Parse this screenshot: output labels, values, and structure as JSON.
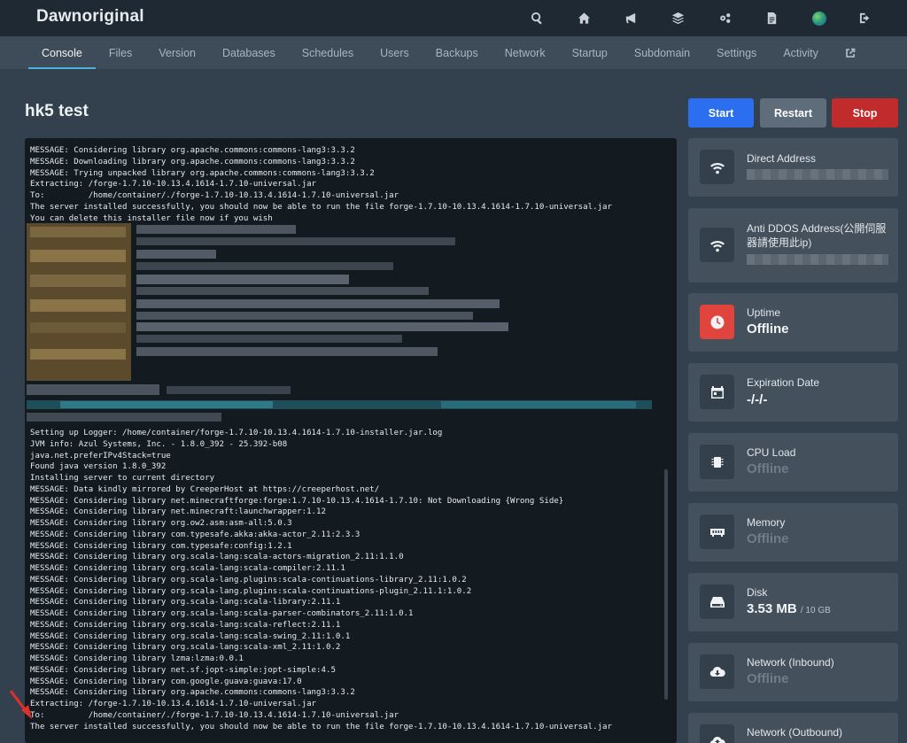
{
  "app": {
    "brand": "Dawnoriginal",
    "top_icons": [
      "search-icon",
      "home-icon",
      "megaphone-icon",
      "layers-icon",
      "cogs-icon",
      "document-icon",
      "avatar",
      "logout-icon"
    ]
  },
  "nav": {
    "tabs": [
      "Console",
      "Files",
      "Version",
      "Databases",
      "Schedules",
      "Users",
      "Backups",
      "Network",
      "Startup",
      "Subdomain",
      "Settings",
      "Activity"
    ],
    "active": "Console",
    "external_icon": "external-link-icon"
  },
  "server": {
    "name": "hk5 test",
    "buttons": {
      "start": "Start",
      "restart": "Restart",
      "stop": "Stop"
    }
  },
  "console": {
    "lines_top": [
      "MESSAGE: Considering library org.apache.commons:commons-lang3:3.3.2",
      "MESSAGE: Downloading library org.apache.commons:commons-lang3:3.3.2",
      "MESSAGE: Trying unpacked library org.apache.commons:commons-lang3:3.3.2",
      "Extracting: /forge-1.7.10-10.13.4.1614-1.7.10-universal.jar",
      "To:         /home/container/./forge-1.7.10-10.13.4.1614-1.7.10-universal.jar",
      "The server installed successfully, you should now be able to run the file forge-1.7.10-10.13.4.1614-1.7.10-universal.jar",
      "You can delete this installer file now if you wish"
    ],
    "lines_bottom": [
      "Setting up Logger: /home/container/forge-1.7.10-10.13.4.1614-1.7.10-installer.jar.log",
      "JVM info: Azul Systems, Inc. - 1.8.0_392 - 25.392-b08",
      "java.net.preferIPv4Stack=true",
      "Found java version 1.8.0_392",
      "Installing server to current directory",
      "MESSAGE: Data kindly mirrored by CreeperHost at https://creeperhost.net/",
      "MESSAGE: Considering library net.minecraftforge:forge:1.7.10-10.13.4.1614-1.7.10: Not Downloading {Wrong Side}",
      "MESSAGE: Considering library net.minecraft:launchwrapper:1.12",
      "MESSAGE: Considering library org.ow2.asm:asm-all:5.0.3",
      "MESSAGE: Considering library com.typesafe.akka:akka-actor_2.11:2.3.3",
      "MESSAGE: Considering library com.typesafe:config:1.2.1",
      "MESSAGE: Considering library org.scala-lang:scala-actors-migration_2.11:1.1.0",
      "MESSAGE: Considering library org.scala-lang:scala-compiler:2.11.1",
      "MESSAGE: Considering library org.scala-lang.plugins:scala-continuations-library_2.11:1.0.2",
      "MESSAGE: Considering library org.scala-lang.plugins:scala-continuations-plugin_2.11.1:1.0.2",
      "MESSAGE: Considering library org.scala-lang:scala-library:2.11.1",
      "MESSAGE: Considering library org.scala-lang:scala-parser-combinators_2.11:1.0.1",
      "MESSAGE: Considering library org.scala-lang:scala-reflect:2.11.1",
      "MESSAGE: Considering library org.scala-lang:scala-swing_2.11:1.0.1",
      "MESSAGE: Considering library org.scala-lang:scala-xml_2.11:1.0.2",
      "MESSAGE: Considering library lzma:lzma:0.0.1",
      "MESSAGE: Considering library net.sf.jopt-simple:jopt-simple:4.5",
      "MESSAGE: Considering library com.google.guava:guava:17.0",
      "MESSAGE: Considering library org.apache.commons:commons-lang3:3.3.2",
      "Extracting: /forge-1.7.10-10.13.4.1614-1.7.10-universal.jar",
      "To:         /home/container/./forge-1.7.10-10.13.4.1614-1.7.10-universal.jar",
      "The server installed successfully, you should now be able to run the file forge-1.7.10-10.13.4.1614-1.7.10-universal.jar"
    ]
  },
  "stats": {
    "direct_address": {
      "label": "Direct Address",
      "icon": "wifi-icon"
    },
    "anti_ddos": {
      "label": "Anti DDOS Address(公開伺服器請使用此ip)",
      "icon": "wifi-icon"
    },
    "uptime": {
      "label": "Uptime",
      "value": "Offline",
      "icon": "clock-icon"
    },
    "expiration": {
      "label": "Expiration Date",
      "value": "-/-/-",
      "icon": "calendar-icon"
    },
    "cpu": {
      "label": "CPU Load",
      "value": "Offline",
      "icon": "chip-icon"
    },
    "memory": {
      "label": "Memory",
      "value": "Offline",
      "icon": "memory-icon"
    },
    "disk": {
      "label": "Disk",
      "value": "3.53 MB",
      "limit": "/ 10 GB",
      "icon": "hdd-icon"
    },
    "net_in": {
      "label": "Network (Inbound)",
      "value": "Offline",
      "icon": "cloud-download-icon"
    },
    "net_out": {
      "label": "Network (Outbound)",
      "icon": "cloud-upload-icon"
    }
  },
  "colors": {
    "accent": "#4bb3d9",
    "start": "#2b6ff0",
    "restart": "#5f6d7a",
    "stop": "#c22b2b",
    "uptime_icon": "#e0443d"
  }
}
